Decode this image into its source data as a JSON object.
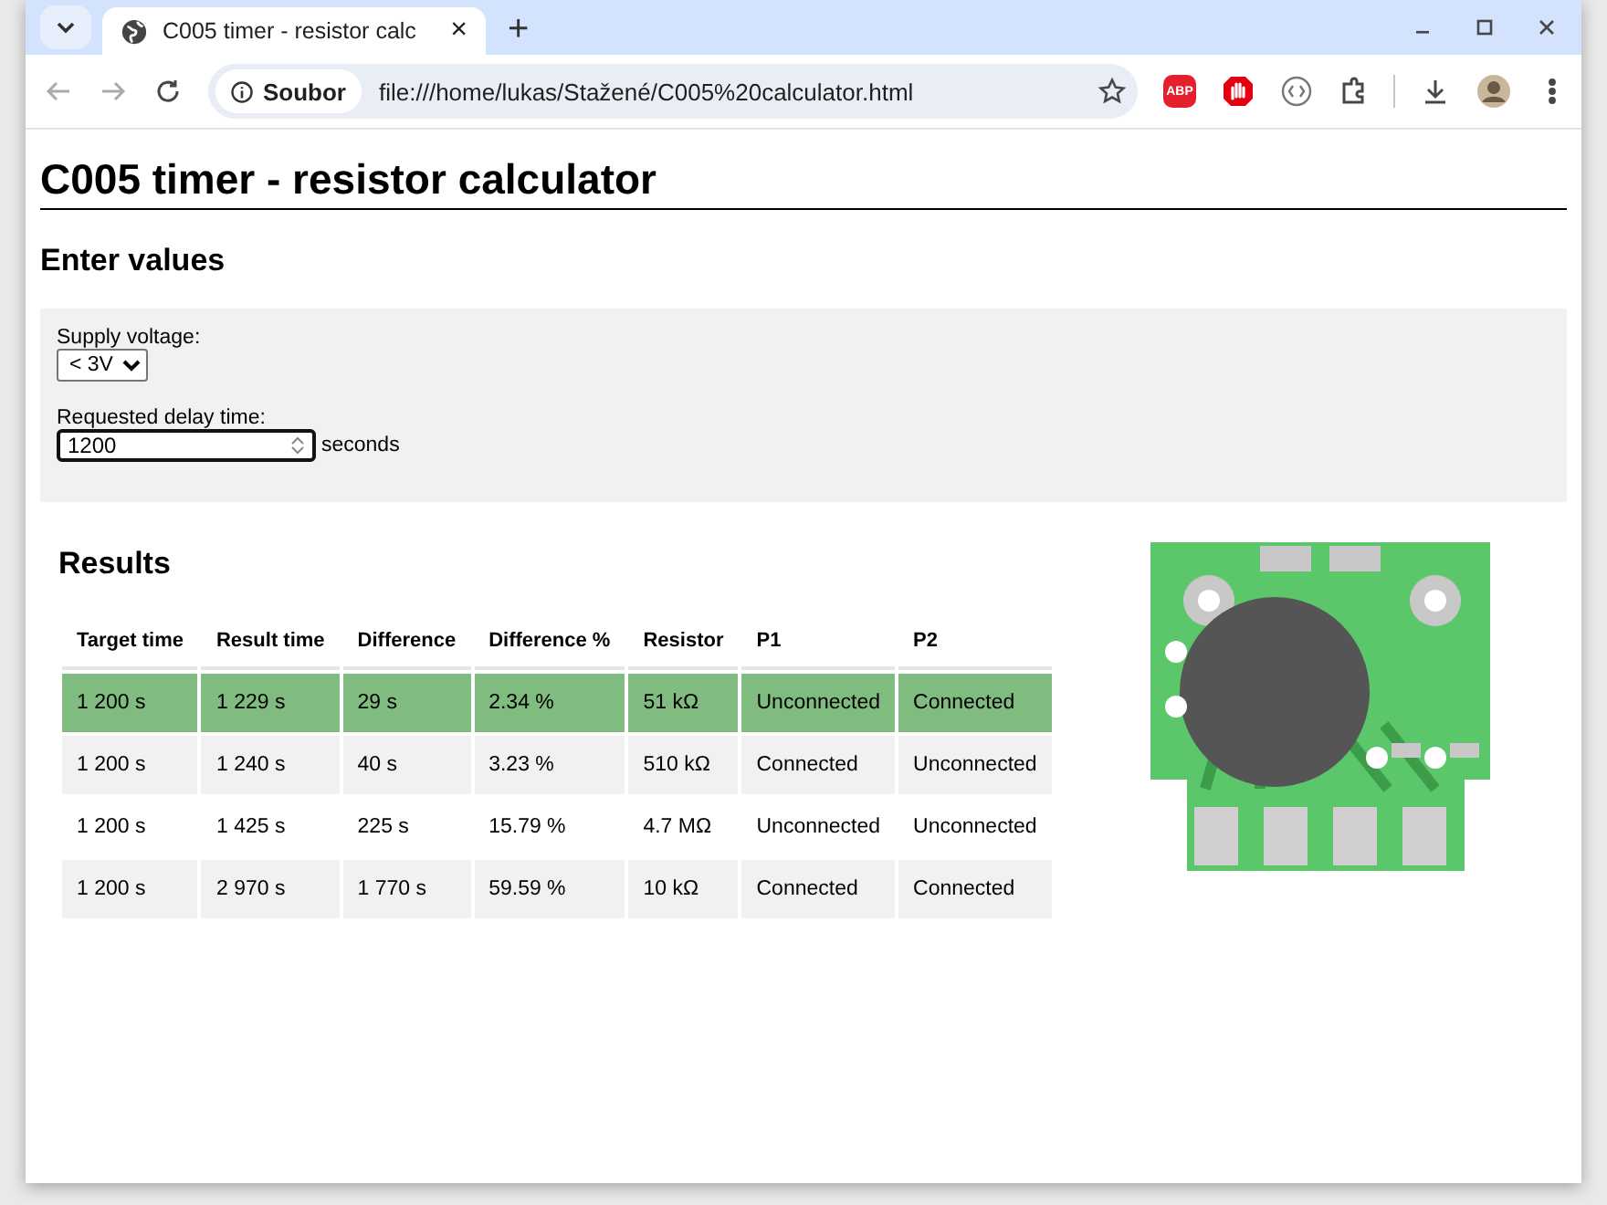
{
  "browser": {
    "tab": {
      "title": "C005 timer - resistor calc",
      "close": "×"
    },
    "new_tab": "+",
    "address": {
      "chip": "Soubor",
      "url": "file:///home/lukas/Stažené/C005%20calculator.html"
    },
    "extensions": [
      {
        "kind": "abp",
        "label": "ABP"
      },
      {
        "kind": "hand"
      },
      {
        "kind": "code"
      },
      {
        "kind": "puzzle"
      }
    ]
  },
  "page": {
    "title": "C005 timer - resistor calculator",
    "form_heading": "Enter values",
    "supply": {
      "label": "Supply voltage:",
      "value": "< 3V"
    },
    "delay": {
      "label": "Requested delay time:",
      "value": "1200",
      "unit": "seconds"
    },
    "results_heading": "Results",
    "table": {
      "columns": [
        "Target time",
        "Result time",
        "Difference",
        "Difference %",
        "Resistor",
        "P1",
        "P2"
      ],
      "rows": [
        {
          "selected": true,
          "cells": [
            "1 200 s",
            "1 229 s",
            "29 s",
            "2.34 %",
            "51 kΩ",
            "Unconnected",
            "Connected"
          ]
        },
        {
          "selected": false,
          "cells": [
            "1 200 s",
            "1 240 s",
            "40 s",
            "3.23 %",
            "510 kΩ",
            "Connected",
            "Unconnected"
          ]
        },
        {
          "selected": false,
          "cells": [
            "1 200 s",
            "1 425 s",
            "225 s",
            "15.79 %",
            "4.7 MΩ",
            "Unconnected",
            "Unconnected"
          ]
        },
        {
          "selected": false,
          "cells": [
            "1 200 s",
            "2 970 s",
            "1 770 s",
            "59.59 %",
            "10 kΩ",
            "Connected",
            "Connected"
          ]
        }
      ]
    }
  }
}
